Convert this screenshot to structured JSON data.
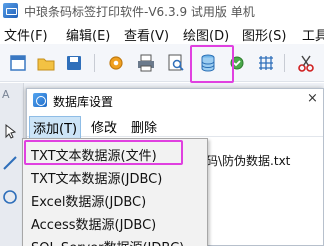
{
  "app": {
    "title": "中琅条码标签打印软件-V6.3.9 试用版 单机"
  },
  "menubar": {
    "items": [
      "文件(F)",
      "编辑(E)",
      "查看(V)",
      "绘图(D)",
      "图形(S)",
      "工具"
    ]
  },
  "toolbar": {
    "buttons": [
      "new-icon",
      "open-icon",
      "save-icon",
      "settings-icon",
      "print-icon",
      "print-preview-icon",
      "database-icon",
      "data-check-icon",
      "grid-icon",
      "cut-icon"
    ],
    "highlighted": "database-icon",
    "highlight_color": "#e040e0"
  },
  "sidebar": {
    "label": "A"
  },
  "dialog": {
    "title": "数据库设置",
    "close_label": "×",
    "menu": [
      "添加(T)",
      "修改",
      "删除"
    ],
    "active_menu": "添加(T)",
    "body_text": "二维码\\防伪数据.txt"
  },
  "dropdown": {
    "items": [
      "TXT文本数据源(文件)",
      "TXT文本数据源(JDBC)",
      "Excel数据源(JDBC)",
      "Access数据源(JDBC)",
      "SQL Server数据源(JDBC)"
    ],
    "highlighted": "TXT文本数据源(文件)",
    "highlight_color": "#e040e0"
  }
}
